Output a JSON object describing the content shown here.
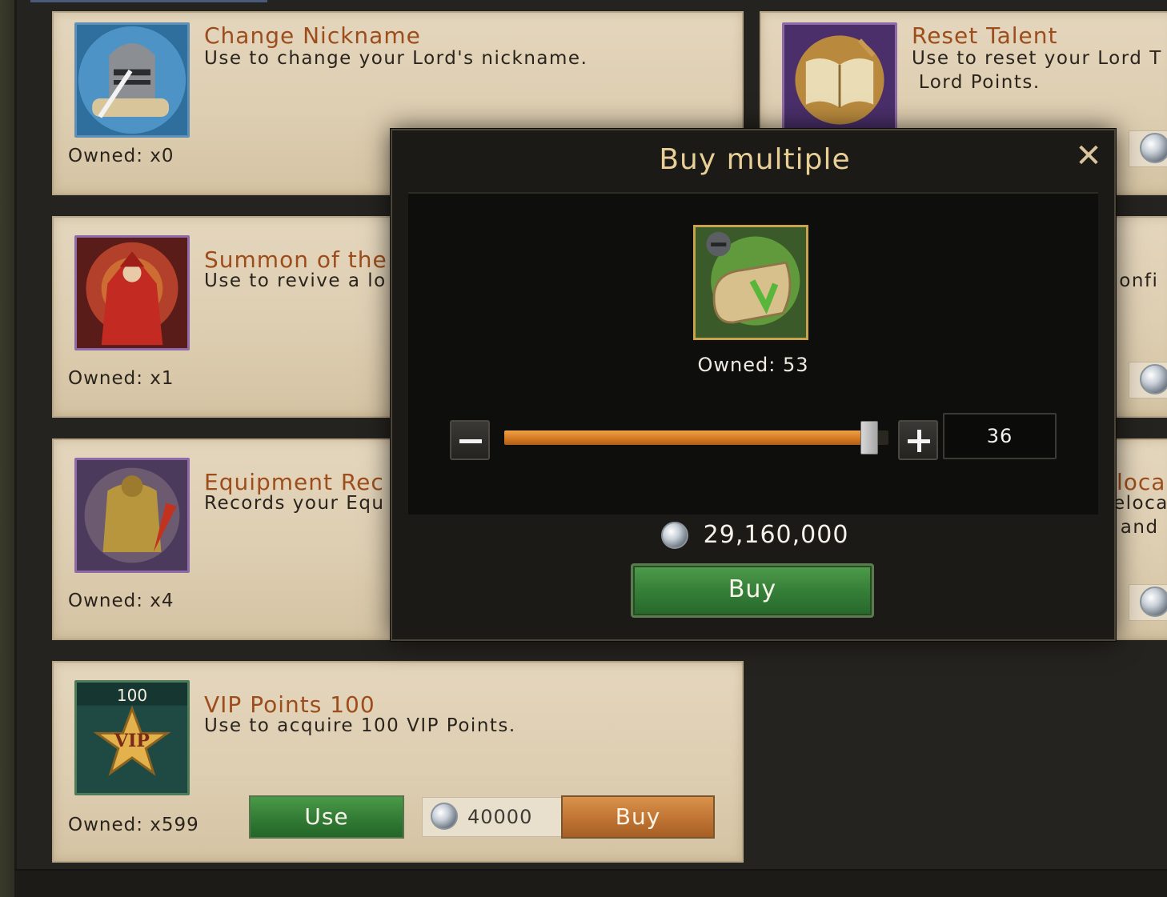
{
  "shop": {
    "cards": [
      {
        "title": "Change Nickname",
        "desc_lines": [
          "Use to change your Lord's nickname."
        ],
        "owned": "Owned: x0",
        "icon": "knight-helmet-scroll-icon"
      },
      {
        "title": "Reset Talent",
        "desc_lines": [
          "Use to reset your Lord T",
          " Lord Points."
        ],
        "owned": "",
        "icon": "open-book-icon"
      },
      {
        "title": "Summon of the",
        "desc_lines": [
          "Use to revive a lo"
        ],
        "owned": "Owned: x1",
        "icon": "red-hooded-mage-icon"
      },
      {
        "title": "",
        "desc_lines": [
          ":onfi"
        ],
        "owned": "",
        "icon": ""
      },
      {
        "title": "Equipment Rec",
        "desc_lines": [
          "Records your Equ"
        ],
        "owned": "Owned: x4",
        "icon": "golden-armor-icon"
      },
      {
        "title": "loca",
        "desc_lines": [
          "eloca",
          " and"
        ],
        "owned": "",
        "icon": ""
      },
      {
        "title": "VIP Points 100",
        "desc_lines": [
          "Use to acquire 100 VIP Points."
        ],
        "owned": "Owned: x599",
        "icon": "vip-star-icon",
        "badge": "100",
        "badge_label": "VIP",
        "use_label": "Use",
        "price": "40000",
        "buy_label": "Buy"
      }
    ]
  },
  "modal": {
    "title": "Buy multiple",
    "close_icon": "close-icon",
    "item_icon": "scroll-with-helmet-icon",
    "owned": "Owned: 53",
    "quantity": "36",
    "slider_fraction": 0.95,
    "total": "29,160,000",
    "buy_label": "Buy"
  },
  "colors": {
    "accent_orange": "#d47a24",
    "buy_green": "#357f38",
    "title_gold": "#e9cf96",
    "card_title": "#9c4d1c"
  }
}
